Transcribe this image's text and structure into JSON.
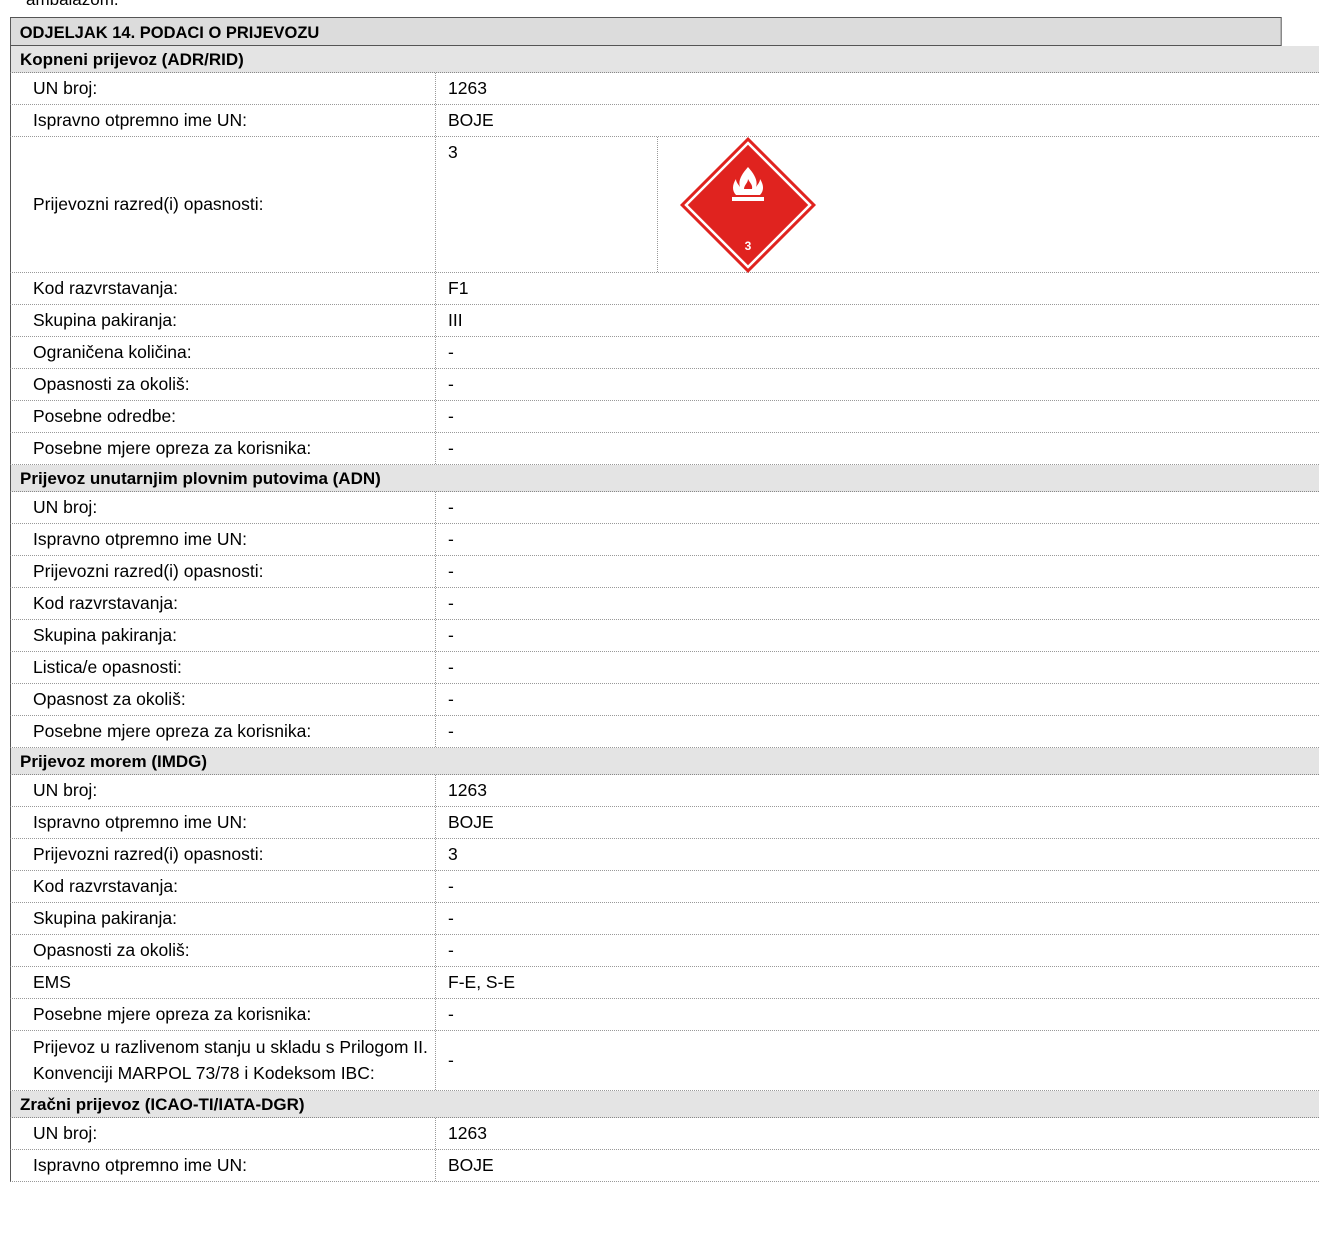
{
  "top_cut_text": "ambalažom.",
  "section_title": "ODJELJAK 14. PODACI O PRIJEVOZU",
  "land": {
    "header": "Kopneni prijevoz (ADR/RID)",
    "rows": [
      {
        "label": "UN broj:",
        "value": "1263"
      },
      {
        "label": "Ispravno otpremno ime UN:",
        "value": "BOJE"
      }
    ],
    "hazard_class": {
      "label": "Prijevozni razred(i) opasnosti:",
      "value": "3",
      "pictogram_number": "3",
      "pictogram_color": "#e0231f"
    },
    "rows2": [
      {
        "label": "Kod razvrstavanja:",
        "value": "F1"
      },
      {
        "label": "Skupina pakiranja:",
        "value": "III"
      },
      {
        "label": "Ograničena količina:",
        "value": "-"
      },
      {
        "label": "Opasnosti za okoliš:",
        "value": "-"
      },
      {
        "label": "Posebne odredbe:",
        "value": "-"
      },
      {
        "label": "Posebne mjere opreza za korisnika:",
        "value": "-"
      }
    ]
  },
  "inland": {
    "header": "Prijevoz unutarnjim plovnim putovima (ADN)",
    "rows": [
      {
        "label": "UN broj:",
        "value": "-"
      },
      {
        "label": "Ispravno otpremno ime UN:",
        "value": "-"
      },
      {
        "label": "Prijevozni razred(i) opasnosti:",
        "value": "-"
      },
      {
        "label": "Kod razvrstavanja:",
        "value": "-"
      },
      {
        "label": "Skupina pakiranja:",
        "value": "-"
      },
      {
        "label": "Listica/e opasnosti:",
        "value": "-"
      },
      {
        "label": "Opasnost za okoliš:",
        "value": "-"
      },
      {
        "label": "Posebne mjere opreza za korisnika:",
        "value": "-"
      }
    ]
  },
  "sea": {
    "header": "Prijevoz morem (IMDG)",
    "rows": [
      {
        "label": "UN broj:",
        "value": "1263"
      },
      {
        "label": "Ispravno otpremno ime UN:",
        "value": "BOJE"
      },
      {
        "label": "Prijevozni razred(i) opasnosti:",
        "value": "3"
      },
      {
        "label": "Kod razvrstavanja:",
        "value": "-"
      },
      {
        "label": "Skupina pakiranja:",
        "value": "-"
      },
      {
        "label": "Opasnosti za okoliš:",
        "value": "-"
      },
      {
        "label": "EMS",
        "value": "F-E, S-E"
      },
      {
        "label": "Posebne mjere opreza za korisnika:",
        "value": "-"
      }
    ],
    "marpol": {
      "label": "Prijevoz u razlivenom stanju u skladu s Prilogom II. Konvenciji MARPOL 73/78 i Kodeksom IBC:",
      "value": "-"
    }
  },
  "air": {
    "header": "Zračni prijevoz (ICAO-TI/IATA-DGR)",
    "rows": [
      {
        "label": "UN broj:",
        "value": "1263"
      },
      {
        "label": "Ispravno otpremno ime UN:",
        "value": "BOJE"
      }
    ]
  }
}
